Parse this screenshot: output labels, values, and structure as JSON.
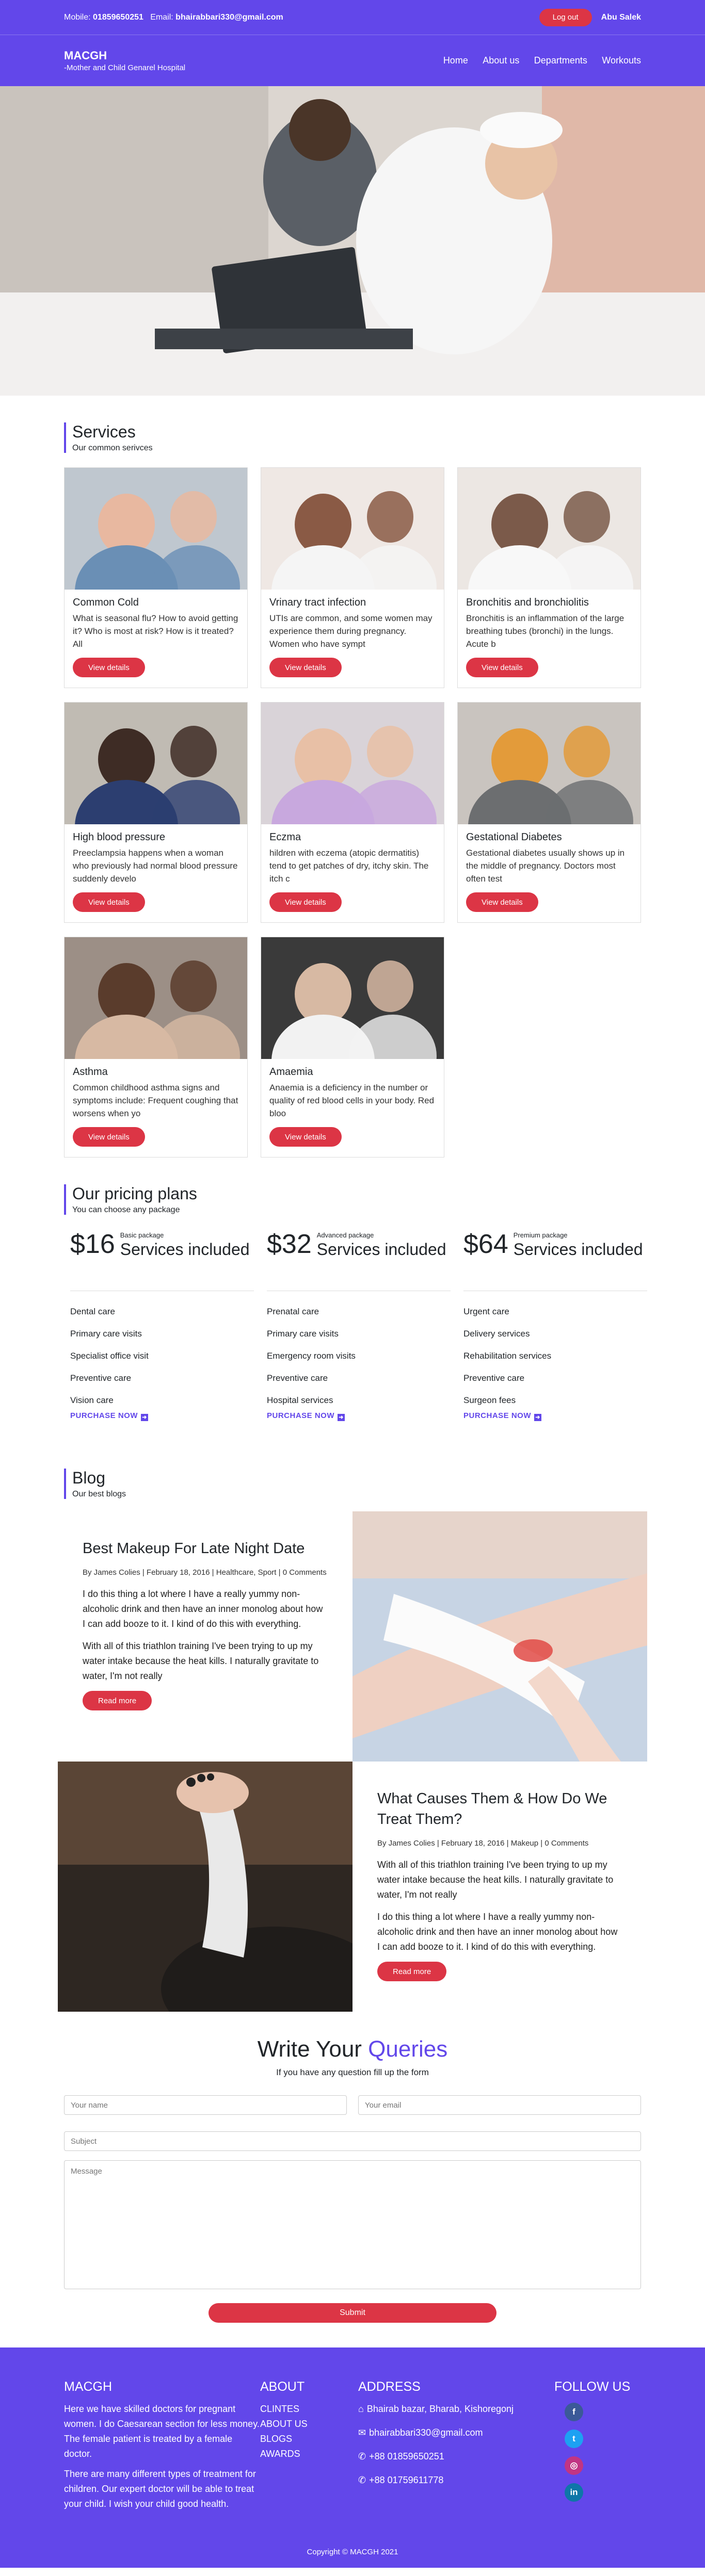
{
  "topbar": {
    "mobile_label": "Mobile:",
    "mobile": "01859650251",
    "email_label": "Email:",
    "email": "bhairabbari330@gmail.com",
    "logout": "Log out",
    "user": "Abu Salek"
  },
  "brand": {
    "title": "MACGH",
    "subtitle": "-Mother and Child Genarel Hospital"
  },
  "nav": [
    "Home",
    "About us",
    "Departments",
    "Workouts"
  ],
  "services": {
    "title": "Services",
    "subtitle": "Our common serivces",
    "button": "View details",
    "items": [
      {
        "title": "Common Cold",
        "text": "What is seasonal flu? How to avoid getting it? Who is most at risk? How is it treated? All"
      },
      {
        "title": "Vrinary tract infection",
        "text": "UTIs are common, and some women may experience them during pregnancy. Women who have sympt"
      },
      {
        "title": "Bronchitis and bronchiolitis",
        "text": "Bronchitis is an inflammation of the large breathing tubes (bronchi) in the lungs. Acute b"
      },
      {
        "title": "High blood pressure",
        "text": "Preeclampsia happens when a woman who previously had normal blood pressure suddenly develo"
      },
      {
        "title": "Eczma",
        "text": "hildren with eczema (atopic dermatitis) tend to get patches of dry, itchy skin. The itch c"
      },
      {
        "title": "Gestational Diabetes",
        "text": "Gestational diabetes usually shows up in the middle of pregnancy. Doctors most often test"
      },
      {
        "title": "Asthma",
        "text": "Common childhood asthma signs and symptoms include: Frequent coughing that worsens when yo"
      },
      {
        "title": "Amaemia",
        "text": "Anaemia is a deficiency in the number or quality of red blood cells in your body. Red bloo"
      }
    ]
  },
  "pricing": {
    "title": "Our pricing plans",
    "subtitle": "You can choose any package",
    "buy": "PURCHASE NOW",
    "plans": [
      {
        "price": "$16",
        "package": "Basic package",
        "included": "Services included",
        "features": [
          "Dental care",
          "Primary care visits",
          "Specialist office visit",
          "Preventive care",
          "Vision care"
        ]
      },
      {
        "price": "$32",
        "package": "Advanced package",
        "included": "Services included",
        "features": [
          "Prenatal care",
          "Primary care visits",
          "Emergency room visits",
          "Preventive care",
          "Hospital services"
        ]
      },
      {
        "price": "$64",
        "package": "Premium package",
        "included": "Services included",
        "features": [
          "Urgent care",
          "Delivery services",
          "Rehabilitation services",
          "Preventive care",
          "Surgeon fees"
        ]
      }
    ]
  },
  "blog": {
    "title": "Blog",
    "subtitle": "Our best blogs",
    "button": "Read more",
    "posts": [
      {
        "title": "Best Makeup For Late Night Date",
        "meta": "By James Colies | February 18, 2016 | Healthcare, Sport | 0 Comments",
        "p1": "I do this thing a lot where I have a really yummy non-alcoholic drink and then have an inner monolog about how I can add booze to it. I kind of do this with everything.",
        "p2": "With all of this triathlon training I've been trying to up my water intake because the heat kills. I naturally gravitate to water, I'm not really"
      },
      {
        "title": "What Causes Them & How Do We Treat Them?",
        "meta": "By James Colies | February 18, 2016 | Makeup | 0 Comments",
        "p1": "With all of this triathlon training I've been trying to up my water intake because the heat kills. I naturally gravitate to water, I'm not really",
        "p2": "I do this thing a lot where I have a really yummy non-alcoholic drink and then have an inner monolog about how I can add booze to it. I kind of do this with everything."
      }
    ]
  },
  "queries": {
    "title_a": "Write Your ",
    "title_b": "Queries",
    "subtitle": "If you have any question fill up the form",
    "name": "Your name",
    "email": "Your email",
    "subject": "Subject",
    "message": "Message",
    "submit": "Submit"
  },
  "footer": {
    "brand": "MACGH",
    "p1": "Here we have skilled doctors for pregnant women. I do Caesarean section for less money. The female patient is treated by a female doctor.",
    "p2": "There are many different types of treatment for children. Our expert doctor will be able to treat your child. I wish your child good health.",
    "about_title": "ABOUT",
    "about": [
      "CLINTES",
      "ABOUT US",
      "BLOGS",
      "AWARDS"
    ],
    "address_title": "ADDRESS",
    "address": [
      "Bhairab bazar, Bharab, Kishoregonj",
      "bhairabbari330@gmail.com",
      "+88 01859650251",
      "+88 01759611778"
    ],
    "follow_title": "FOLLOW US",
    "copyright": "Copyright © MACGH 2021"
  },
  "colors": {
    "primary": "#6247ea",
    "danger": "#dc3545",
    "facebook": "#3b5998",
    "twitter": "#1da1f2",
    "instagram": "#c13584",
    "linkedin": "#0e76a8"
  }
}
